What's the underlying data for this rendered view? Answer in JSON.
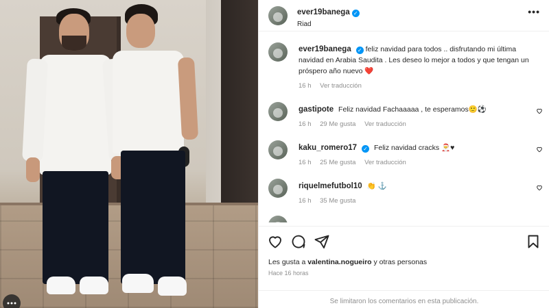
{
  "post": {
    "username": "ever19banega",
    "location": "Riad",
    "more_label": "•••"
  },
  "caption": {
    "username": "ever19banega",
    "text": "feliz navidad para todos .. disfrutando mi última navidad en Arabia Saudita . Les deseo lo mejor a todos y que tengan un próspero año nuevo",
    "emoji": "❤️",
    "time": "16 h",
    "translate": "Ver traducción"
  },
  "comments": [
    {
      "username": "gastipote",
      "text": "Feliz navidad Fachaaaaa , te esperamos🙂⚽",
      "time": "16 h",
      "likes": "29 Me gusta",
      "translate": "Ver traducción",
      "verified": false
    },
    {
      "username": "kaku_romero17",
      "text": "Feliz navidad cracks 🎅♥",
      "time": "16 h",
      "likes": "25 Me gusta",
      "translate": "Ver traducción",
      "verified": true
    },
    {
      "username": "riquelmefutbol10",
      "text": "👏 ⚓",
      "time": "16 h",
      "likes": "35 Me gusta",
      "translate": "",
      "verified": false
    },
    {
      "username": "...",
      "text": "",
      "time": "",
      "likes": "",
      "translate": "",
      "verified": false
    }
  ],
  "likes": {
    "prefix": "Les gusta a",
    "user": "valentina.nogueiro",
    "suffix": "y otras personas"
  },
  "posted_ago": "Hace 16 horas",
  "limited_notice": "Se limitaron los comentarios en esta publicación.",
  "colors": {
    "verified": "#0095f6",
    "muted": "#8e8e8e",
    "text": "#262626"
  }
}
